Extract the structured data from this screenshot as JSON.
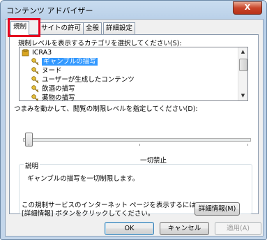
{
  "window": {
    "title": "コンテンツ アドバイザー",
    "close_glyph": "X"
  },
  "tabs": [
    {
      "label": "規制"
    },
    {
      "label": "サイトの許可"
    },
    {
      "label": "全般"
    },
    {
      "label": "詳細設定"
    }
  ],
  "ratings": {
    "instruction": "規制レベルを表示するカテゴリを選択してください(S):",
    "tree": [
      {
        "label": "ICRA3",
        "icon": "rating-system-icon"
      },
      {
        "label": "ギャンブルの描写",
        "icon": "key-icon",
        "selected": true
      },
      {
        "label": "ヌード",
        "icon": "key-icon"
      },
      {
        "label": "ユーザーが生成したコンテンツ",
        "icon": "key-icon"
      },
      {
        "label": "飲酒の描写",
        "icon": "key-icon"
      },
      {
        "label": "薬物の描写",
        "icon": "key-icon"
      }
    ]
  },
  "slider": {
    "instruction": "つまみを動かして、閲覧の制限レベルを指定してください(D):",
    "level_label": "一切禁止",
    "position": 0
  },
  "description": {
    "group_label": "説明",
    "text": "ギャンブルの描写を一切制限します。",
    "more_info_line1": "この規制サービスのインターネット ページを表示するには、",
    "more_info_line2": "[詳細情報] ボタンをクリックしてください。",
    "more_info_button": "詳細情報(M)"
  },
  "footer": {
    "ok": "OK",
    "cancel": "キャンセル",
    "apply": "適用(A)"
  },
  "colors": {
    "highlight_box": "#e4001f",
    "selection": "#3399ff"
  }
}
